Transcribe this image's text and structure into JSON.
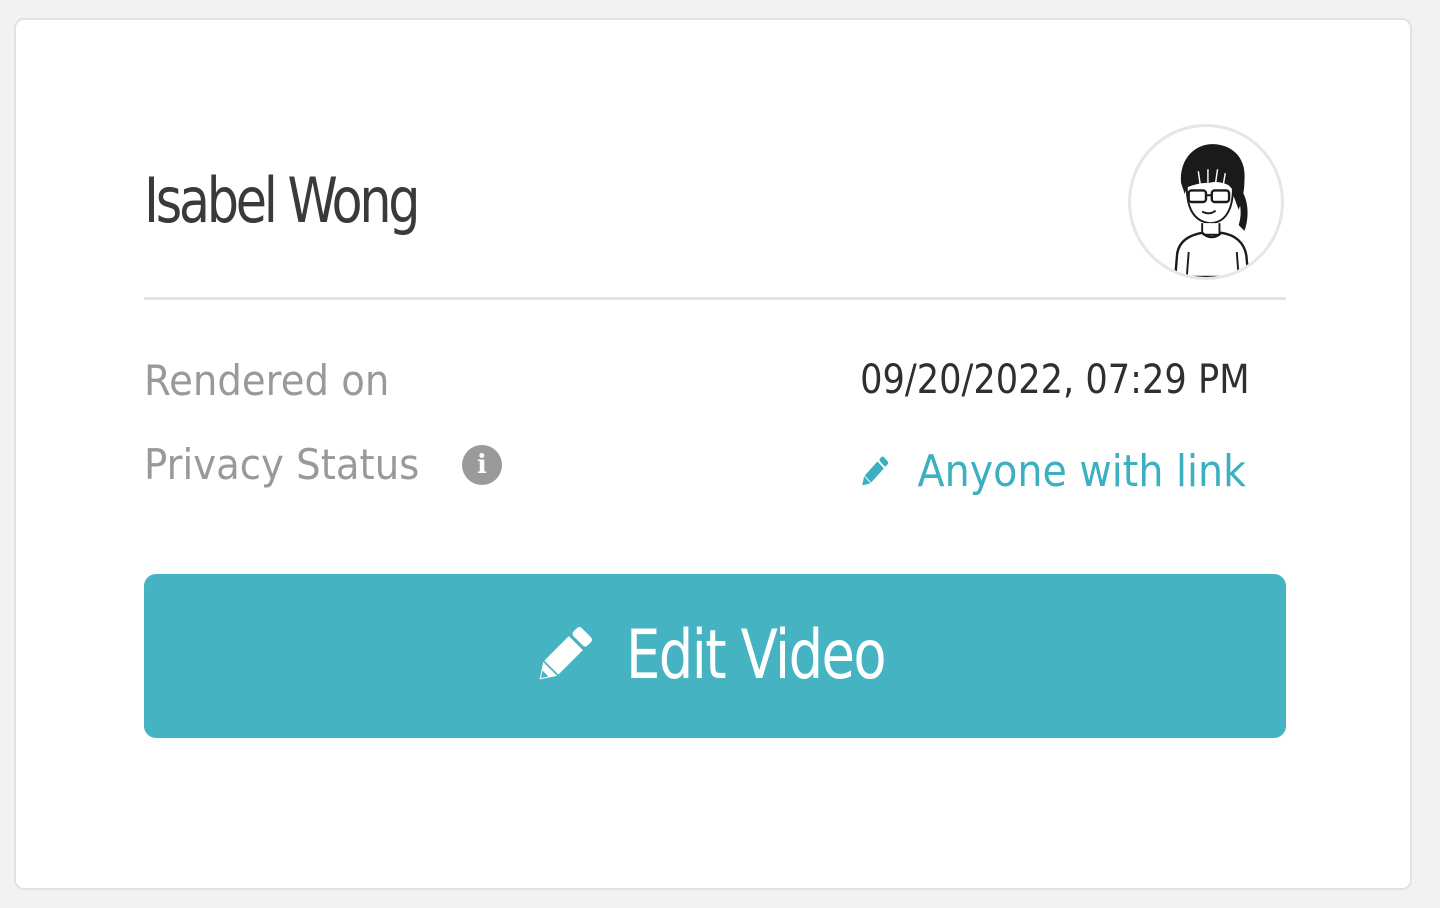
{
  "card": {
    "user_name": "Isabel Wong",
    "rendered_label": "Rendered on",
    "rendered_value": "09/20/2022, 07:29 PM",
    "privacy_label": "Privacy Status",
    "privacy_value": "Anyone with link",
    "info_glyph": "i",
    "edit_button_label": "Edit Video"
  },
  "icons": {
    "avatar": "user-avatar-illustration",
    "info": "info-icon",
    "privacy_edit": "pencil-icon",
    "edit_button": "pencil-icon"
  },
  "colors": {
    "accent": "#45b3c1",
    "link": "#3ab0c0",
    "label": "#999999",
    "text": "#2f2f2f"
  }
}
